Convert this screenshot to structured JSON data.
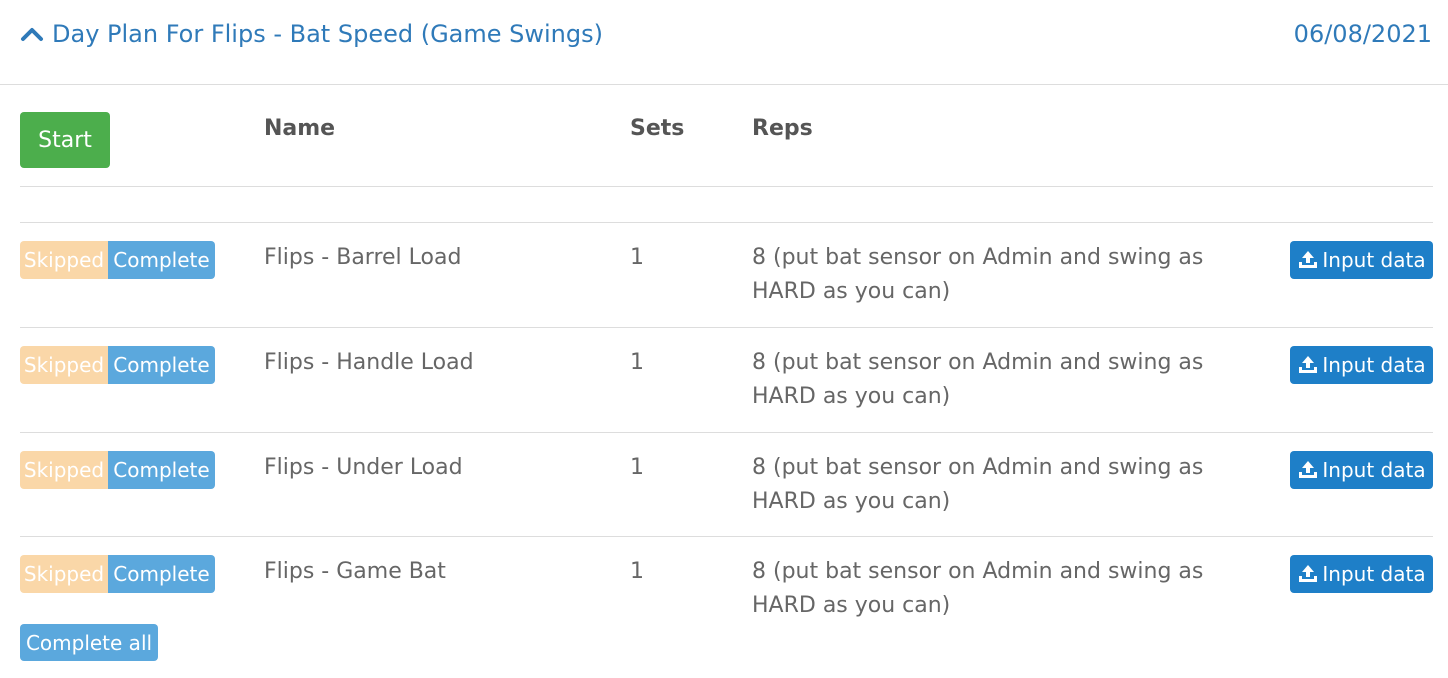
{
  "header": {
    "title": "Day Plan For Flips - Bat Speed (Game Swings)",
    "date": "06/08/2021",
    "collapse_icon": "chevron-up-icon"
  },
  "toolbar": {
    "start_label": "Start"
  },
  "table": {
    "columns": [
      "Name",
      "Sets",
      "Reps"
    ],
    "rows": [
      {
        "name": "Flips - Barrel Load",
        "sets": "1",
        "reps": "8 (put bat sensor on Admin and swing as HARD as you can)",
        "skipped_label": "Skipped",
        "complete_label": "Complete",
        "input_label": "Input data"
      },
      {
        "name": "Flips - Handle Load",
        "sets": "1",
        "reps": "8 (put bat sensor on Admin and swing as HARD as you can)",
        "skipped_label": "Skipped",
        "complete_label": "Complete",
        "input_label": "Input data"
      },
      {
        "name": "Flips - Under Load",
        "sets": "1",
        "reps": "8 (put bat sensor on Admin and swing as HARD as you can)",
        "skipped_label": "Skipped",
        "complete_label": "Complete",
        "input_label": "Input data"
      },
      {
        "name": "Flips - Game Bat",
        "sets": "1",
        "reps": "8 (put bat sensor on Admin and swing as HARD as you can)",
        "skipped_label": "Skipped",
        "complete_label": "Complete",
        "input_label": "Input data"
      }
    ]
  },
  "footer": {
    "complete_all_label": "Complete all"
  },
  "colors": {
    "title": "#2f7ab9",
    "start": "#4cae4c",
    "skipped": "#fad7a8",
    "complete": "#5ba8dd",
    "input": "#1e7fc8",
    "upload_icon": "upload-icon"
  }
}
